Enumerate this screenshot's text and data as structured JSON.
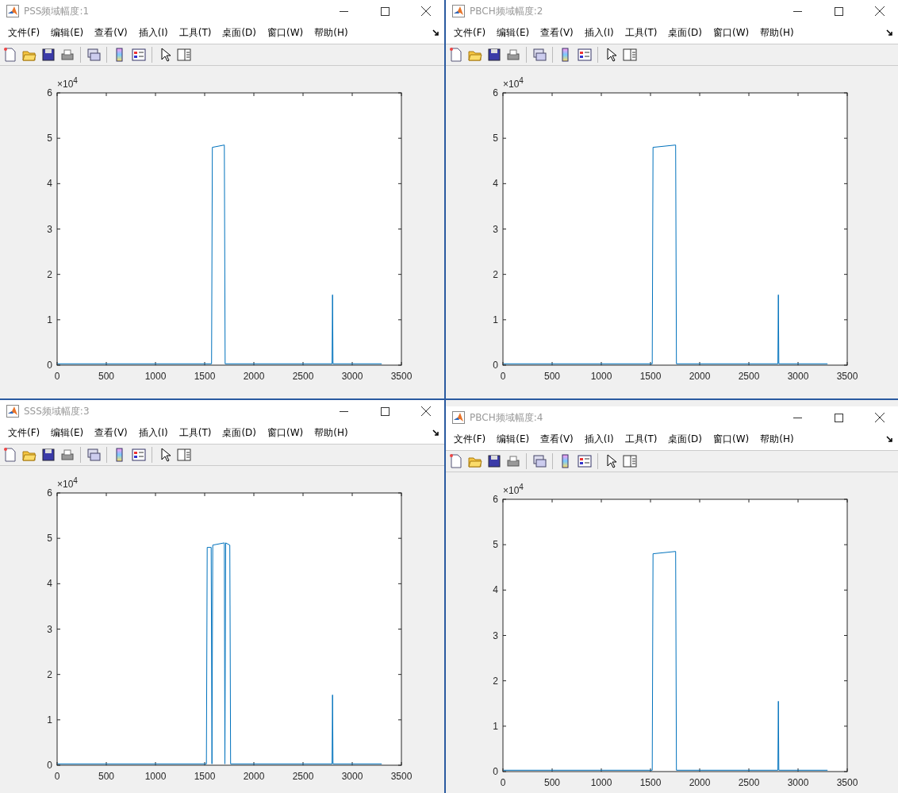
{
  "windows": [
    {
      "title": "PSS频域幅度:1",
      "menu": [
        "文件(F)",
        "编辑(E)",
        "查看(V)",
        "插入(I)",
        "工具(T)",
        "桌面(D)",
        "窗口(W)",
        "帮助(H)"
      ],
      "exponent_label": "×10$^{4}$",
      "chart_data": {
        "type": "line",
        "x": [
          5,
          1570,
          1578,
          1700,
          1708,
          2795,
          2800,
          2805,
          3300
        ],
        "series": [
          {
            "color": "#0072bd",
            "values": [
              0.03,
              0.03,
              4.8,
              4.85,
              0.03,
              0.03,
              1.55,
              0.03,
              0.03
            ]
          }
        ],
        "xlim": [
          0,
          3500
        ],
        "ylim": [
          0,
          6
        ],
        "xticks": [
          0,
          500,
          1000,
          1500,
          2000,
          2500,
          3000,
          3500
        ],
        "yticks": [
          0,
          1,
          2,
          3,
          4,
          5,
          6
        ]
      }
    },
    {
      "title": "PBCH频域幅度:2",
      "menu": [
        "文件(F)",
        "编辑(E)",
        "查看(V)",
        "插入(I)",
        "工具(T)",
        "桌面(D)",
        "窗口(W)",
        "帮助(H)"
      ],
      "exponent_label": "×10$^{4}$",
      "chart_data": {
        "type": "line",
        "x": [
          5,
          1518,
          1526,
          1756,
          1764,
          2795,
          2800,
          2805,
          3300
        ],
        "series": [
          {
            "color": "#0072bd",
            "values": [
              0.03,
              0.03,
              4.8,
              4.85,
              0.03,
              0.03,
              1.55,
              0.03,
              0.03
            ]
          }
        ],
        "xlim": [
          0,
          3500
        ],
        "ylim": [
          0,
          6
        ],
        "xticks": [
          0,
          500,
          1000,
          1500,
          2000,
          2500,
          3000,
          3500
        ],
        "yticks": [
          0,
          1,
          2,
          3,
          4,
          5,
          6
        ]
      }
    },
    {
      "title": "SSS频域幅度:3",
      "menu": [
        "文件(F)",
        "编辑(E)",
        "查看(V)",
        "插入(I)",
        "工具(T)",
        "桌面(D)",
        "窗口(W)",
        "帮助(H)"
      ],
      "exponent_label": "×10$^{4}$",
      "chart_data": {
        "type": "line",
        "x": [
          5,
          1518,
          1526,
          1566,
          1574,
          1582,
          1700,
          1706,
          1714,
          1756,
          1764,
          2795,
          2800,
          2805,
          3300
        ],
        "series": [
          {
            "color": "#0072bd",
            "values": [
              0.03,
              0.03,
              4.8,
              4.8,
              0.03,
              4.85,
              4.9,
              0.03,
              4.9,
              4.85,
              0.03,
              0.03,
              1.55,
              0.03,
              0.03
            ]
          }
        ],
        "xlim": [
          0,
          3500
        ],
        "ylim": [
          0,
          6
        ],
        "xticks": [
          0,
          500,
          1000,
          1500,
          2000,
          2500,
          3000,
          3500
        ],
        "yticks": [
          0,
          1,
          2,
          3,
          4,
          5,
          6
        ]
      }
    },
    {
      "title": "PBCH频域幅度:4",
      "menu": [
        "文件(F)",
        "编辑(E)",
        "查看(V)",
        "插入(I)",
        "工具(T)",
        "桌面(D)",
        "窗口(W)",
        "帮助(H)"
      ],
      "exponent_label": "×10$^{4}$",
      "chart_data": {
        "type": "line",
        "x": [
          5,
          1518,
          1526,
          1756,
          1764,
          2795,
          2800,
          2805,
          3300
        ],
        "series": [
          {
            "color": "#0072bd",
            "values": [
              0.03,
              0.03,
              4.8,
              4.85,
              0.03,
              0.03,
              1.55,
              0.03,
              0.03
            ]
          }
        ],
        "xlim": [
          0,
          3500
        ],
        "ylim": [
          0,
          6
        ],
        "xticks": [
          0,
          500,
          1000,
          1500,
          2000,
          2500,
          3000,
          3500
        ],
        "yticks": [
          0,
          1,
          2,
          3,
          4,
          5,
          6
        ]
      }
    }
  ]
}
